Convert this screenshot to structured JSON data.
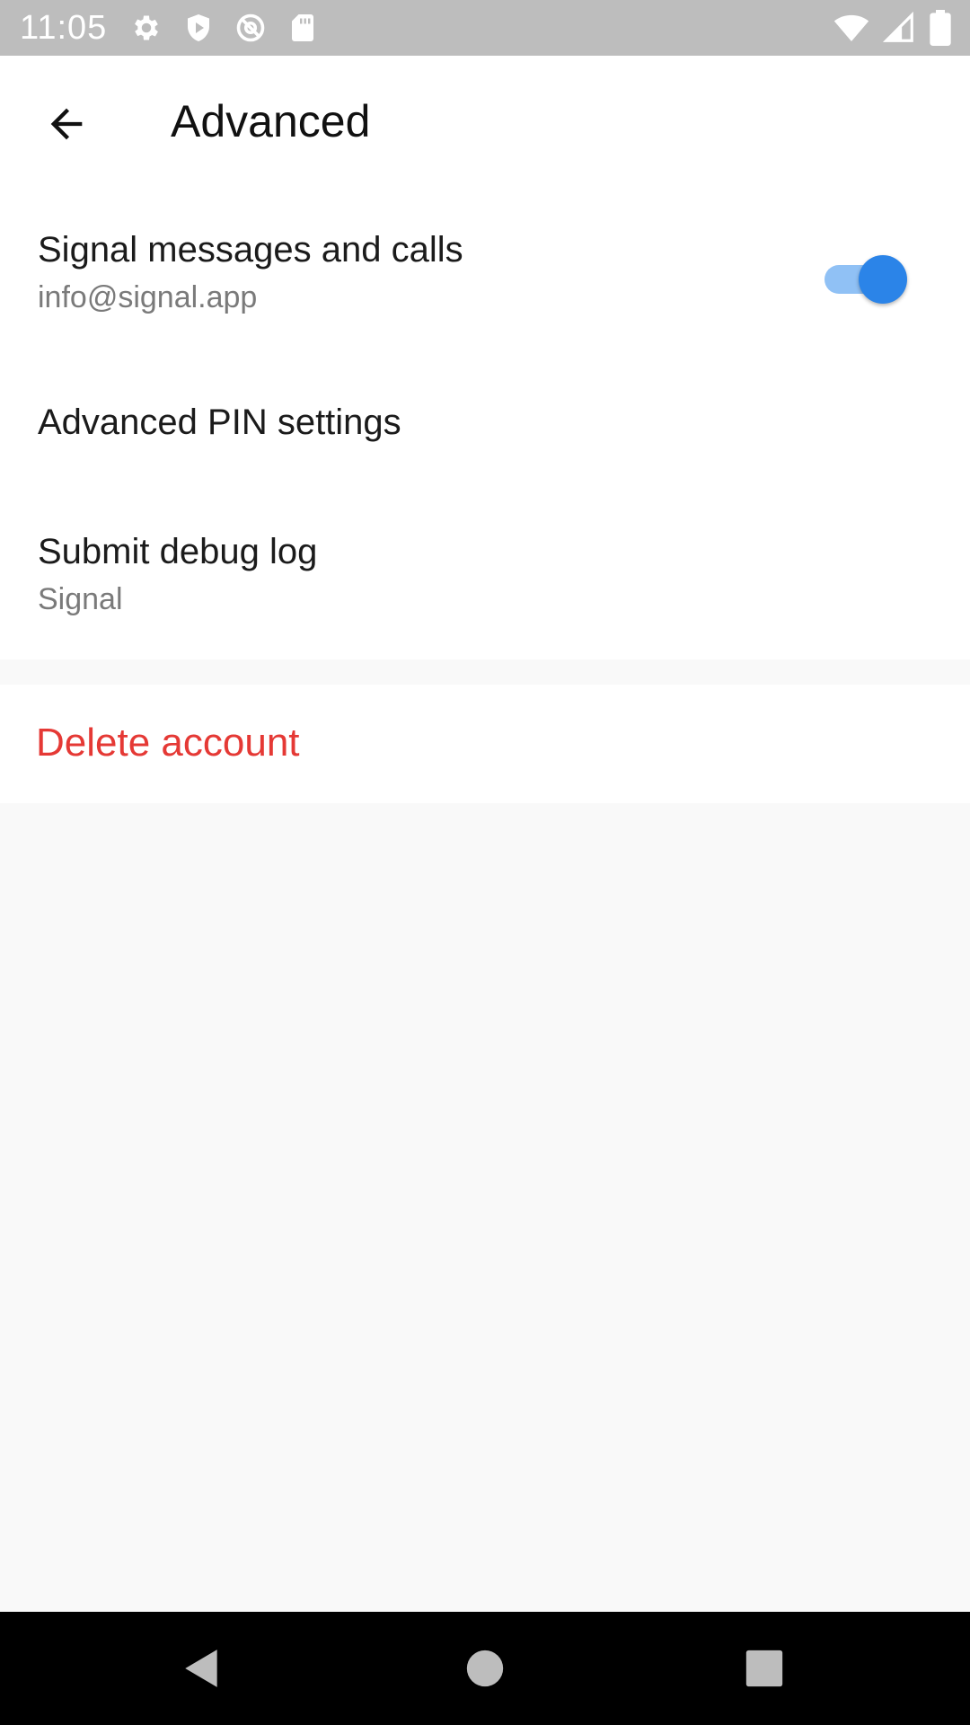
{
  "status_bar": {
    "time": "11:05",
    "left_icons": [
      "settings-icon",
      "shield-icon",
      "at-sign-icon",
      "sd-card-icon"
    ],
    "right_icons": [
      "wifi-icon",
      "cellular-signal-icon",
      "battery-icon"
    ]
  },
  "app_bar": {
    "back_icon": "arrow-back-icon",
    "title": "Advanced"
  },
  "settings": {
    "signal_messages": {
      "title": "Signal messages and calls",
      "subtitle": "info@signal.app",
      "enabled": true
    },
    "advanced_pin": {
      "title": "Advanced PIN settings"
    },
    "debug_log": {
      "title": "Submit debug log",
      "subtitle": "Signal"
    }
  },
  "delete_account": {
    "label": "Delete account",
    "color": "#e53935"
  },
  "colors": {
    "accent": "#2b84e8",
    "accent_track": "#90c1f5",
    "background": "#f9f9f9",
    "status_bar": "#bdbdbd"
  },
  "nav_bar": {
    "icons": [
      "nav-back-icon",
      "nav-home-icon",
      "nav-recents-icon"
    ]
  }
}
